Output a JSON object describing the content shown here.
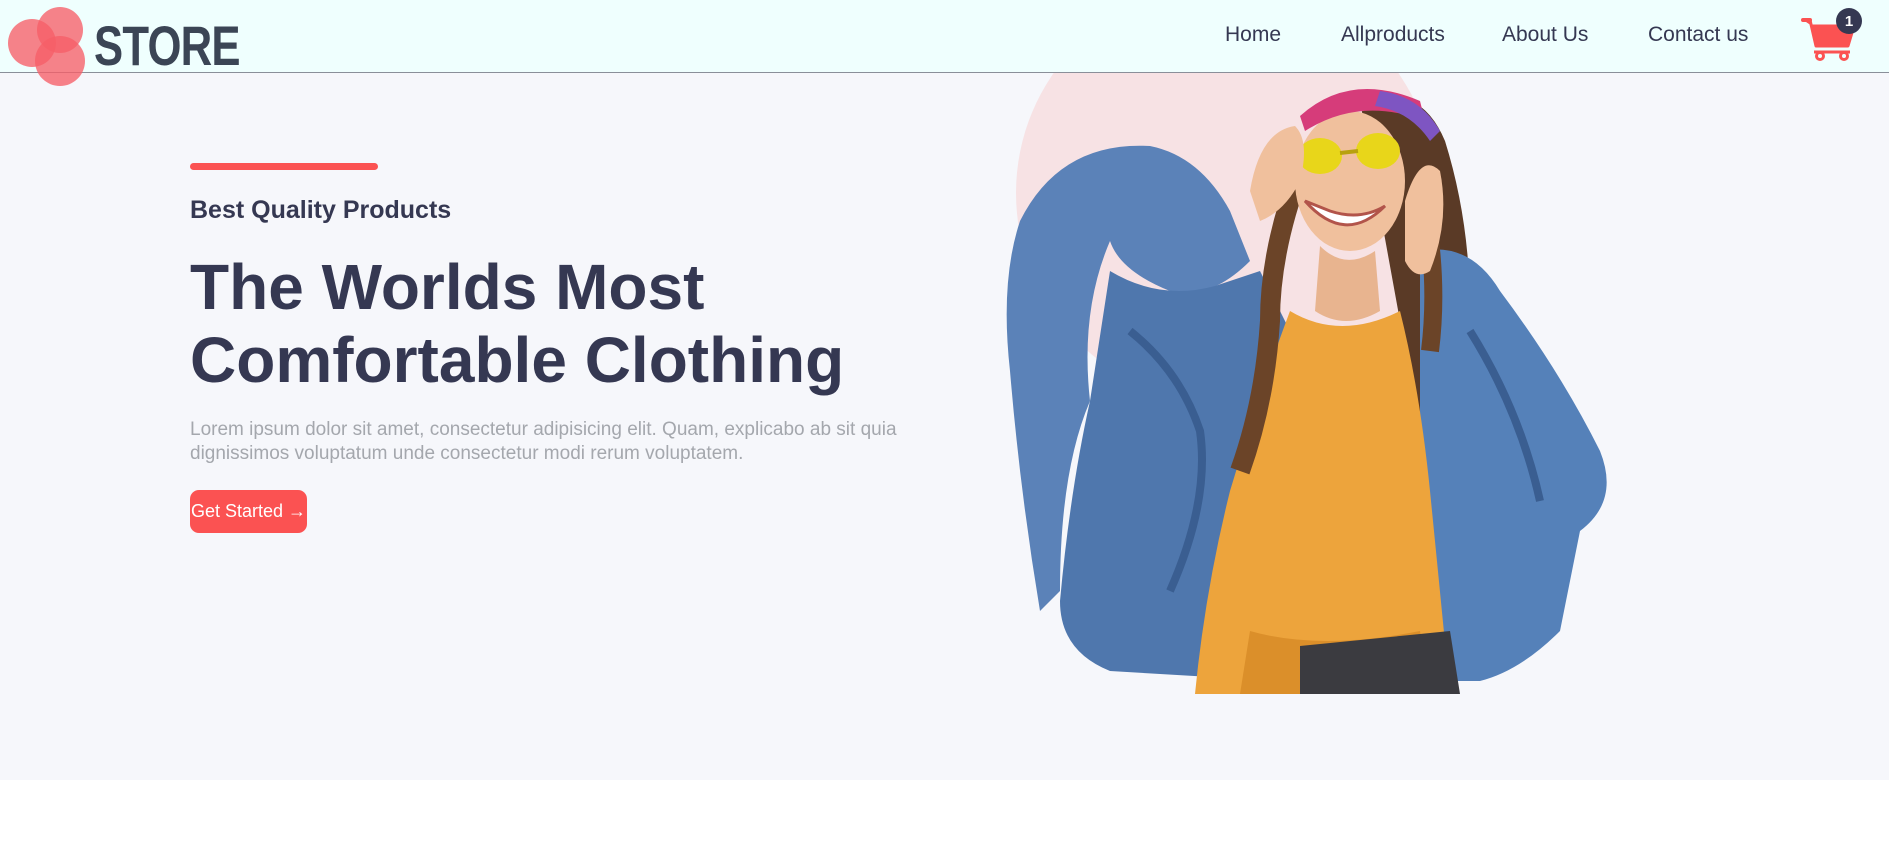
{
  "brand": {
    "logo_text": "STORE",
    "accent_color": "#fb5252",
    "text_color": "#353852"
  },
  "nav": {
    "links": [
      "Home",
      "Allproducts",
      "About Us",
      "Contact us"
    ],
    "cart": {
      "icon": "cart-icon",
      "count": "1"
    }
  },
  "hero": {
    "subtitle": "Best Quality Products",
    "title_line1": "The Worlds Most",
    "title_line2": "Comfortable Clothing",
    "description": "Lorem ipsum dolor sit amet, consectetur adipisicing elit. Quam, explicabo ab sit quia dignissimos voluptatum unde consectetur modi rerum voluptatem.",
    "cta_label": "Get Started →",
    "image": "woman-denim-jacket-photo"
  }
}
